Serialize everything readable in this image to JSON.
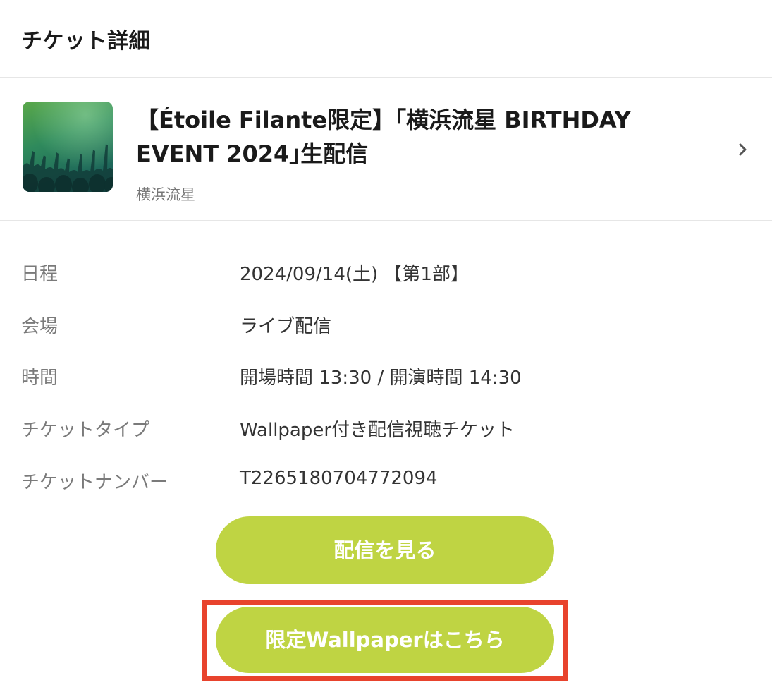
{
  "header": {
    "title": "チケット詳細"
  },
  "event": {
    "title": "【Étoile Filante限定】｢横浜流星 BIRTHDAY EVENT 2024｣生配信",
    "artist": "横浜流星",
    "thumbnail_icon": "concert-crowd-image",
    "chevron_icon": "chevron-right-icon"
  },
  "details": [
    {
      "label": "日程",
      "value": "2024/09/14(土) 【第1部】"
    },
    {
      "label": "会場",
      "value": "ライブ配信"
    },
    {
      "label": "時間",
      "value": "開場時間 13:30 / 開演時間 14:30"
    },
    {
      "label": "チケットタイプ",
      "value": "Wallpaper付き配信視聴チケット"
    },
    {
      "label": "チケットナンバー",
      "value": "T2265180704772094"
    }
  ],
  "buttons": {
    "watch_label": "配信を見る",
    "wallpaper_label": "限定Wallpaperはこちら"
  },
  "colors": {
    "button_bg": "#bfd443",
    "highlight_border": "#e8432d",
    "label_text": "#7a7a7a"
  }
}
